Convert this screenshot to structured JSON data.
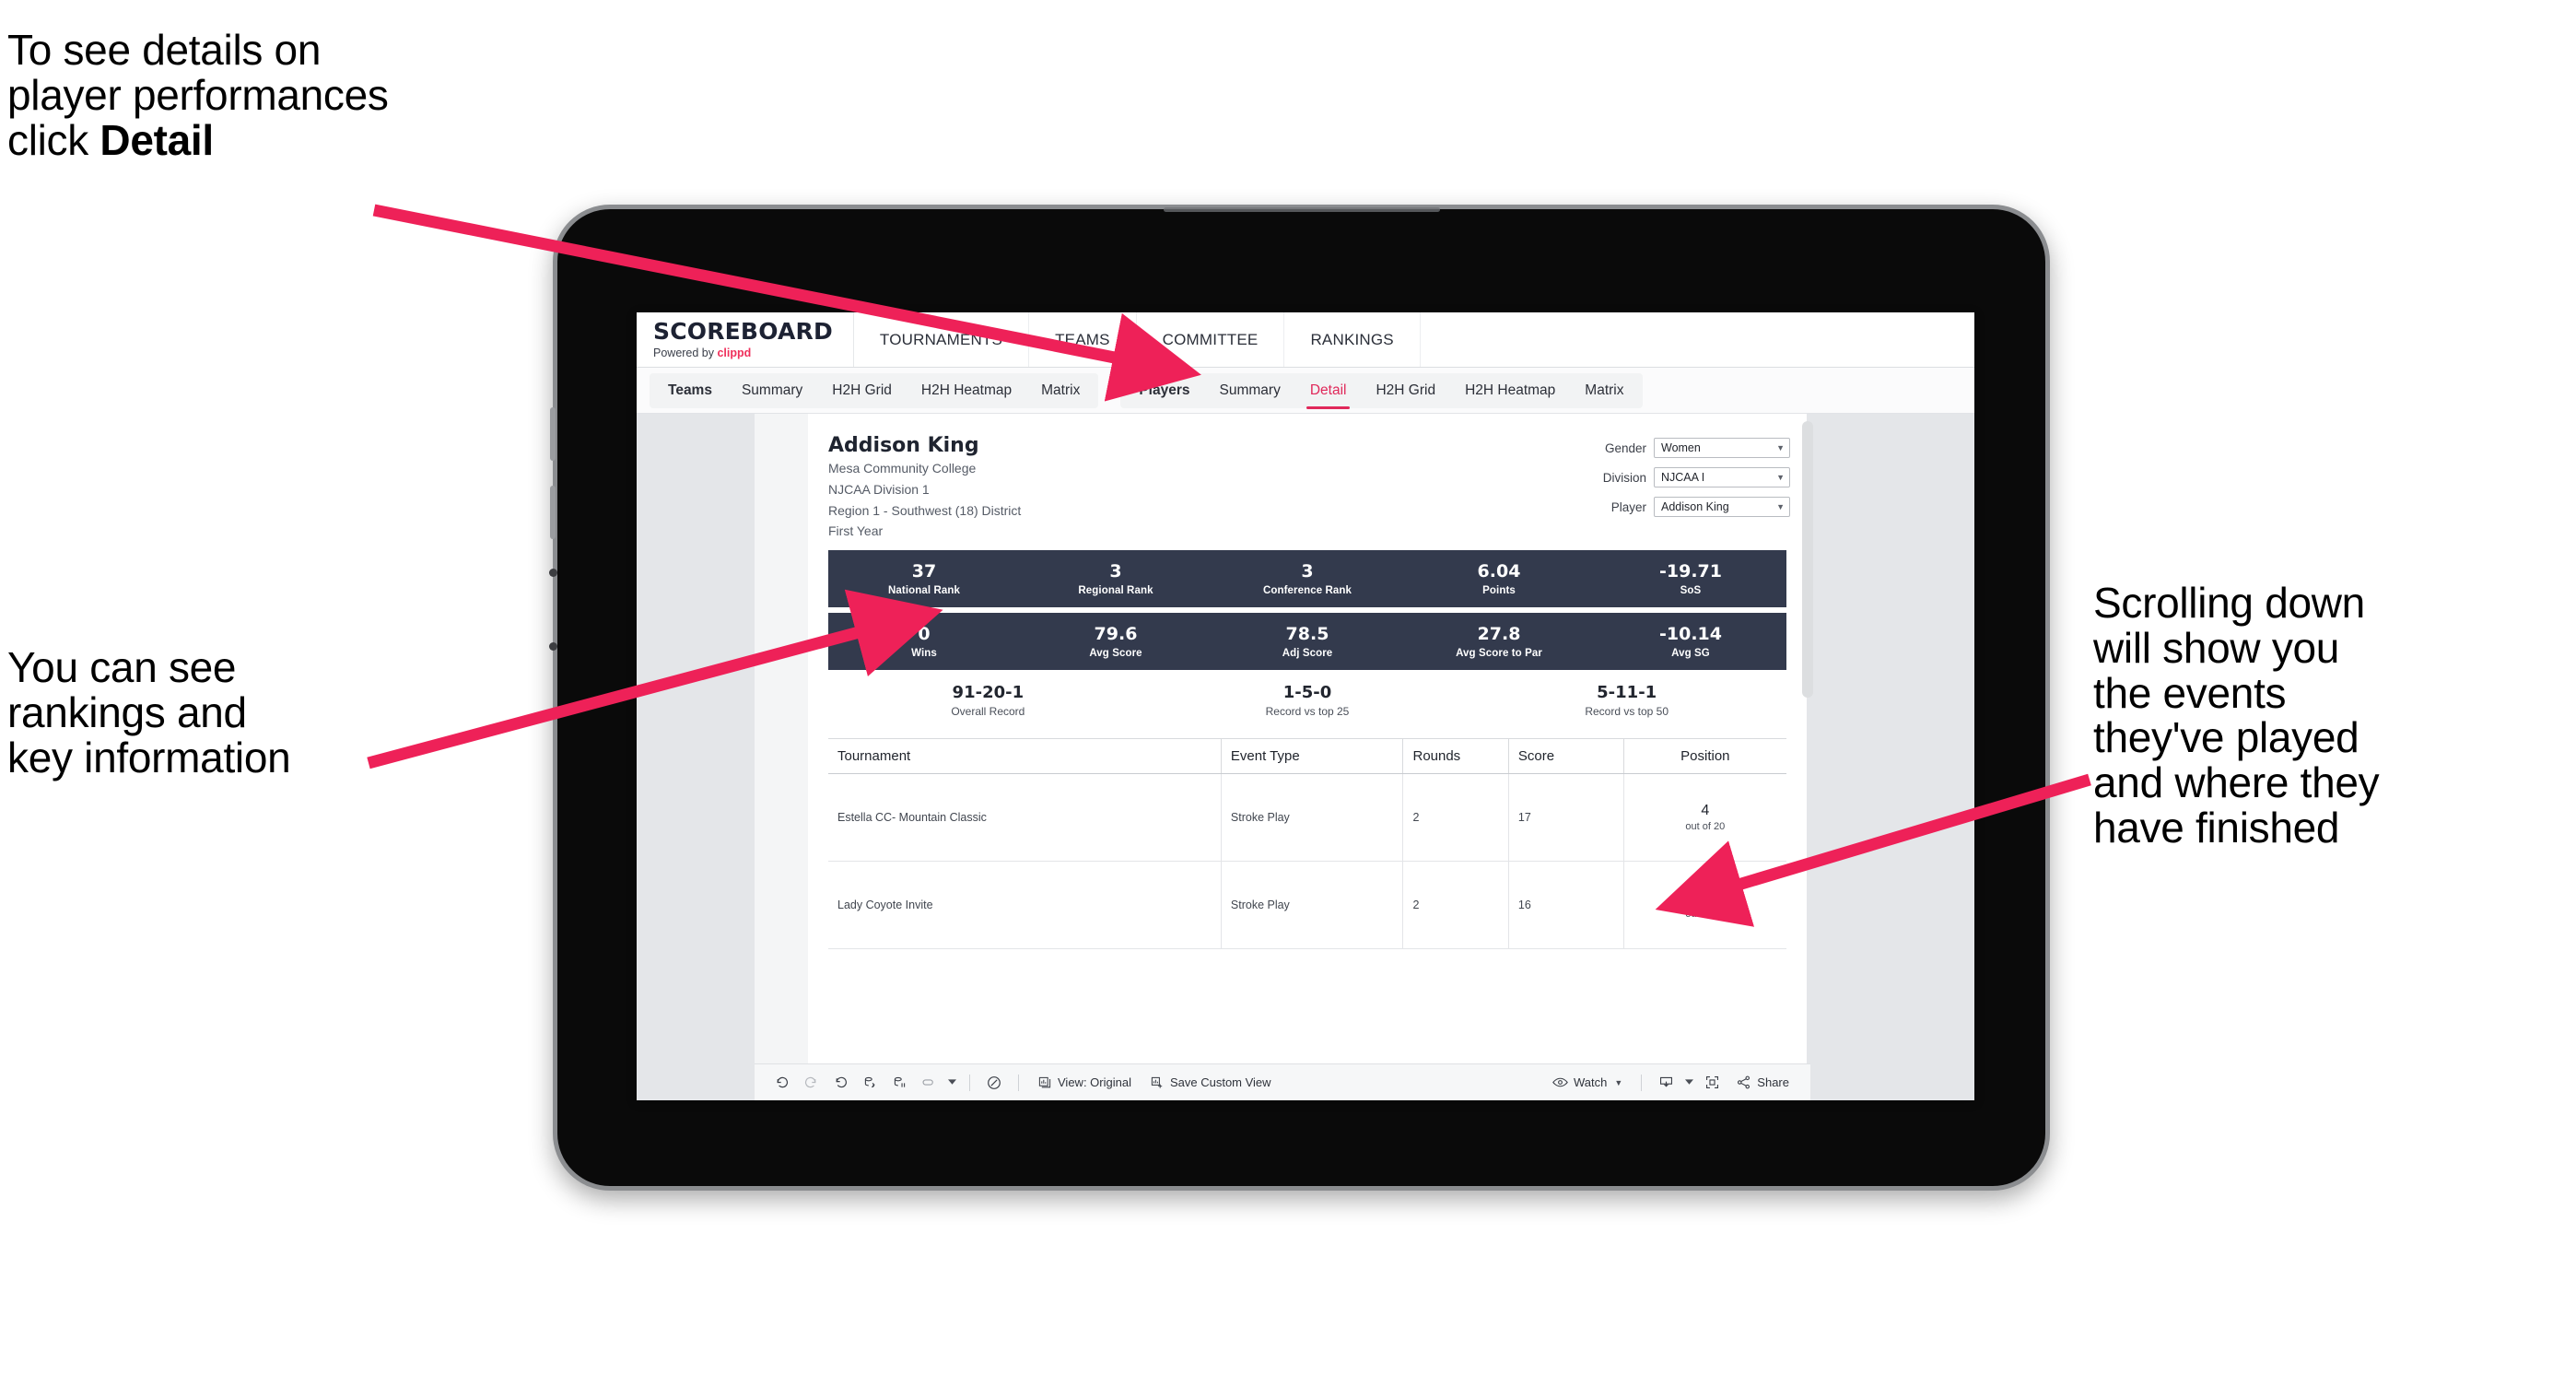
{
  "annotations": {
    "top_left": "To see details on\nplayer performances\nclick ",
    "top_left_bold": "Detail",
    "left": "You can see\nrankings and\nkey information",
    "right": "Scrolling down\nwill show you\nthe events\nthey've played\nand where they\nhave finished"
  },
  "colors": {
    "accent_pink": "#e0285a",
    "arrow_pink": "#ee2158",
    "band_navy": "#333a4d",
    "page_bg": "#e4e6e9"
  },
  "app": {
    "brand": {
      "title": "SCOREBOARD",
      "powered_prefix": "Powered by ",
      "powered_brand": "clippd"
    },
    "nav": [
      "TOURNAMENTS",
      "TEAMS",
      "COMMITTEE",
      "RANKINGS"
    ],
    "teams_tabs": [
      {
        "label": "Teams",
        "lead": true,
        "active": false
      },
      {
        "label": "Summary",
        "lead": false,
        "active": false
      },
      {
        "label": "H2H Grid",
        "lead": false,
        "active": false
      },
      {
        "label": "H2H Heatmap",
        "lead": false,
        "active": false
      },
      {
        "label": "Matrix",
        "lead": false,
        "active": false
      }
    ],
    "players_tabs": [
      {
        "label": "Players",
        "lead": true,
        "active": false
      },
      {
        "label": "Summary",
        "lead": false,
        "active": false
      },
      {
        "label": "Detail",
        "lead": false,
        "active": true
      },
      {
        "label": "H2H Grid",
        "lead": false,
        "active": false
      },
      {
        "label": "H2H Heatmap",
        "lead": false,
        "active": false
      },
      {
        "label": "Matrix",
        "lead": false,
        "active": false
      }
    ]
  },
  "player": {
    "name": "Addison King",
    "school": "Mesa Community College",
    "division": "NJCAA Division 1",
    "region": "Region 1 - Southwest (18) District",
    "year": "First Year"
  },
  "filters": [
    {
      "label": "Gender",
      "value": "Women"
    },
    {
      "label": "Division",
      "value": "NJCAA I"
    },
    {
      "label": "Player",
      "value": "Addison King"
    }
  ],
  "stat_bands": [
    [
      {
        "value": "37",
        "label": "National Rank"
      },
      {
        "value": "3",
        "label": "Regional Rank"
      },
      {
        "value": "3",
        "label": "Conference Rank"
      },
      {
        "value": "6.04",
        "label": "Points"
      },
      {
        "value": "-19.71",
        "label": "SoS"
      }
    ],
    [
      {
        "value": "0",
        "label": "Wins"
      },
      {
        "value": "79.6",
        "label": "Avg Score"
      },
      {
        "value": "78.5",
        "label": "Adj Score"
      },
      {
        "value": "27.8",
        "label": "Avg Score to Par"
      },
      {
        "value": "-10.14",
        "label": "Avg SG"
      }
    ]
  ],
  "records": [
    {
      "value": "91-20-1",
      "label": "Overall Record"
    },
    {
      "value": "1-5-0",
      "label": "Record vs top 25"
    },
    {
      "value": "5-11-1",
      "label": "Record vs top 50"
    }
  ],
  "events_table": {
    "headers": [
      "Tournament",
      "Event Type",
      "Rounds",
      "Score",
      "Position"
    ],
    "rows": [
      {
        "tournament": "Estella CC- Mountain Classic",
        "event_type": "Stroke Play",
        "rounds": "2",
        "score": "17",
        "position_num": "4",
        "position_out": "out of 20"
      },
      {
        "tournament": "Lady Coyote Invite",
        "event_type": "Stroke Play",
        "rounds": "2",
        "score": "16",
        "position_num": "7",
        "position_out": "out of 20"
      }
    ]
  },
  "toolbar": {
    "view_label": "View: Original",
    "save_label": "Save Custom View",
    "watch_label": "Watch",
    "share_label": "Share"
  }
}
